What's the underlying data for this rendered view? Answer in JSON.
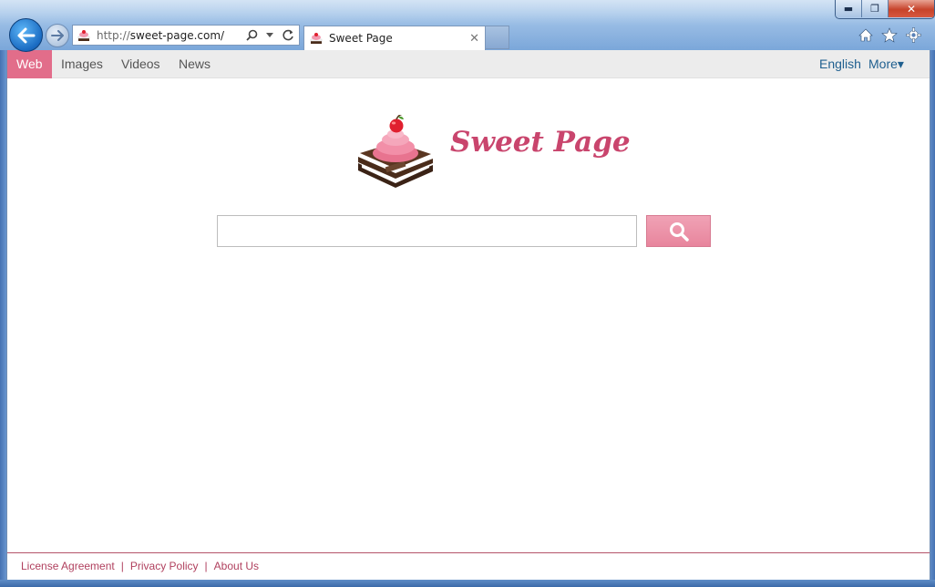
{
  "browser": {
    "address_proto": "http://",
    "address_host": "sweet-page.com/",
    "tab_title": "Sweet Page",
    "window_buttons": {
      "minimize": "▬",
      "maximize": "❐",
      "close": "✕"
    },
    "icons": [
      "back-arrow-icon",
      "forward-arrow-icon",
      "search-icon",
      "dropdown-icon",
      "refresh-icon",
      "close-tab-icon",
      "home-icon",
      "star-icon",
      "gear-icon"
    ]
  },
  "nav": {
    "items": [
      {
        "label": "Web",
        "active": true
      },
      {
        "label": "Images"
      },
      {
        "label": "Videos"
      },
      {
        "label": "News"
      }
    ],
    "language": "English",
    "more": "More▾"
  },
  "logo": {
    "text": "Sweet Page"
  },
  "search": {
    "value": "",
    "placeholder": ""
  },
  "footer": {
    "links": [
      "License Agreement",
      "Privacy Policy",
      "About Us"
    ],
    "separator": "|"
  },
  "colors": {
    "accent": "#e26d8a",
    "footer_text": "#b0405e",
    "lang_link": "#1f5f8f"
  }
}
